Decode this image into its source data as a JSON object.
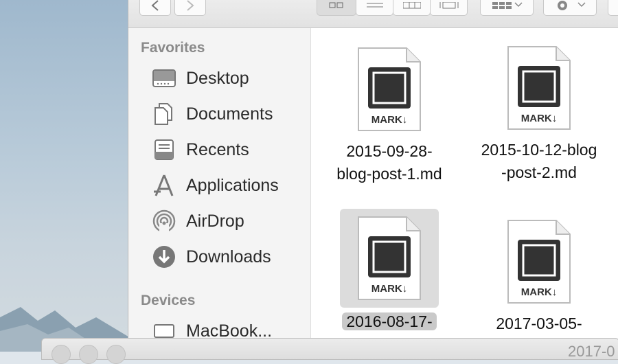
{
  "sidebar": {
    "favorites_header": "Favorites",
    "items": [
      {
        "label": "Desktop",
        "icon": "desktop-icon"
      },
      {
        "label": "Documents",
        "icon": "documents-icon"
      },
      {
        "label": "Recents",
        "icon": "recents-icon"
      },
      {
        "label": "Applications",
        "icon": "applications-icon"
      },
      {
        "label": "AirDrop",
        "icon": "airdrop-icon"
      },
      {
        "label": "Downloads",
        "icon": "downloads-icon"
      }
    ],
    "devices_header": "Devices",
    "devices": [
      {
        "label": "MacBook...",
        "icon": "laptop-icon"
      }
    ]
  },
  "files": [
    {
      "name_line1": "2015-09-28-",
      "name_line2": "blog-post-1.md",
      "badge": "MARK↓",
      "selected": false
    },
    {
      "name_line1": "2015-10-12-blog",
      "name_line2": "-post-2.md",
      "badge": "MARK↓",
      "selected": false
    },
    {
      "name_line1": "2016-08-17-",
      "name_line2": "",
      "badge": "MARK↓",
      "selected": true
    },
    {
      "name_line1": "2017-03-05-",
      "name_line2": "",
      "badge": "MARK↓",
      "selected": false
    }
  ],
  "bottom_window": {
    "title": "2017-0"
  },
  "colors": {
    "sidebar_bg": "#f4f4f4",
    "selection": "#dcdcdc",
    "text": "#2a2a2a",
    "header": "#8a8a8a"
  }
}
